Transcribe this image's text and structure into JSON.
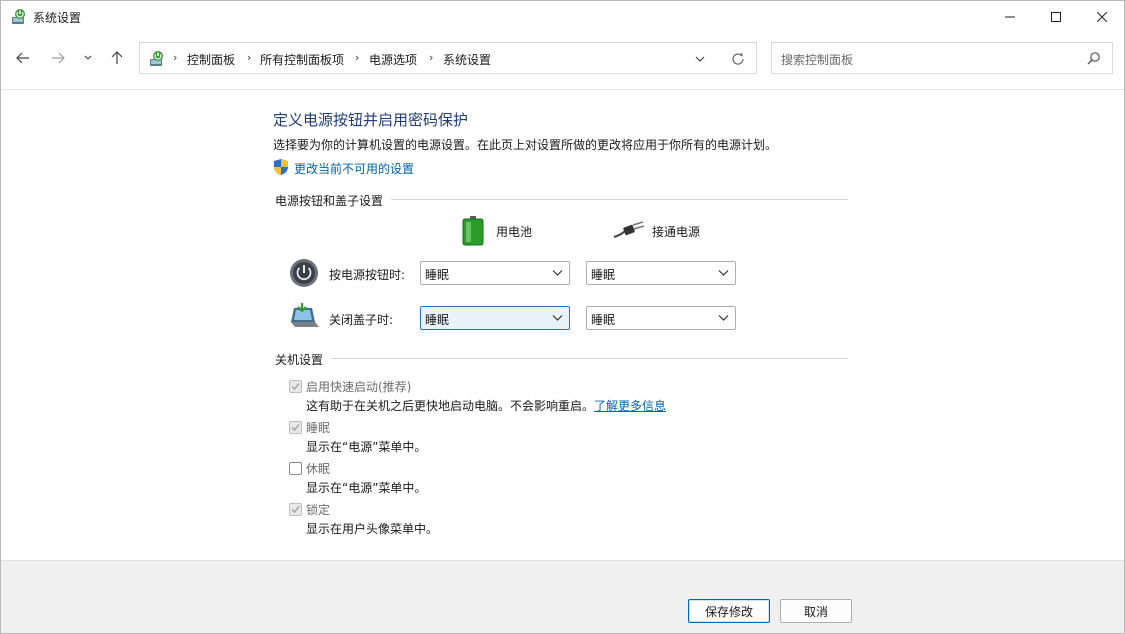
{
  "window": {
    "title": "系统设置",
    "controls": {
      "minimize": "minimize",
      "maximize": "maximize",
      "close": "close"
    }
  },
  "nav": {
    "breadcrumbs": [
      "控制面板",
      "所有控制面板项",
      "电源选项",
      "系统设置"
    ],
    "search_placeholder": "搜索控制面板"
  },
  "page": {
    "heading": "定义电源按钮并启用密码保护",
    "description": "选择要为你的计算机设置的电源设置。在此页上对设置所做的更改将应用于你所有的电源计划。",
    "admin_link": "更改当前不可用的设置"
  },
  "power_section": {
    "title": "电源按钮和盖子设置",
    "columns": {
      "battery": "用电池",
      "plugged": "接通电源"
    },
    "rows": [
      {
        "label": "按电源按钮时:",
        "battery": "睡眠",
        "plugged": "睡眠"
      },
      {
        "label": "关闭盖子时:",
        "battery": "睡眠",
        "plugged": "睡眠"
      }
    ]
  },
  "shutdown_section": {
    "title": "关机设置",
    "options": [
      {
        "label": "启用快速启动(推荐)",
        "checked": true,
        "description": "这有助于在关机之后更快地启动电脑。不会影响重启。",
        "link": "了解更多信息"
      },
      {
        "label": "睡眠",
        "checked": true,
        "description": "显示在“电源”菜单中。"
      },
      {
        "label": "休眠",
        "checked": false,
        "description": "显示在“电源”菜单中。"
      },
      {
        "label": "锁定",
        "checked": true,
        "description": "显示在用户头像菜单中。"
      }
    ]
  },
  "footer": {
    "save": "保存修改",
    "cancel": "取消"
  }
}
